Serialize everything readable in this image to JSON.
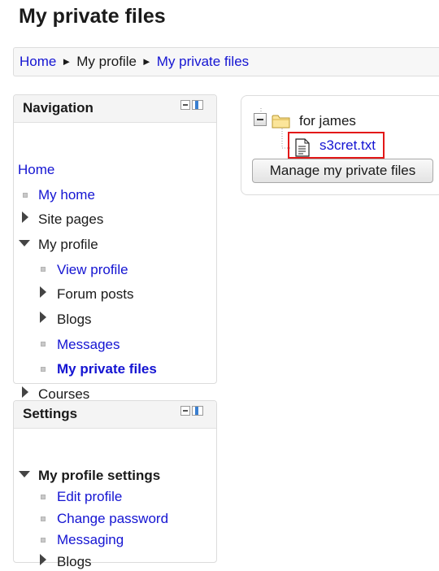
{
  "page": {
    "title": "My private files"
  },
  "breadcrumb": {
    "items": [
      "Home",
      "My profile",
      "My private files"
    ],
    "separator": "►"
  },
  "navigation": {
    "title": "Navigation",
    "home": "Home",
    "my_home": "My home",
    "site_pages": "Site pages",
    "my_profile": "My profile",
    "view_profile": "View profile",
    "forum_posts": "Forum posts",
    "blogs": "Blogs",
    "messages": "Messages",
    "my_private_files": "My private files",
    "courses": "Courses"
  },
  "settings": {
    "title": "Settings",
    "my_profile_settings": "My profile settings",
    "edit_profile": "Edit profile",
    "change_password": "Change password",
    "messaging": "Messaging",
    "blogs": "Blogs"
  },
  "files": {
    "folder_name": "for james",
    "file_name": "s3cret.txt",
    "manage_button": "Manage my private files"
  },
  "colors": {
    "link": "#1414d2",
    "highlight": "#e31818",
    "block_header": "#f4f4f4"
  },
  "icons": [
    "collapse-minus-icon",
    "dock-icon",
    "folder-icon",
    "text-file-icon",
    "bullet-icon",
    "expand-arrow-icon",
    "collapse-arrow-icon"
  ]
}
